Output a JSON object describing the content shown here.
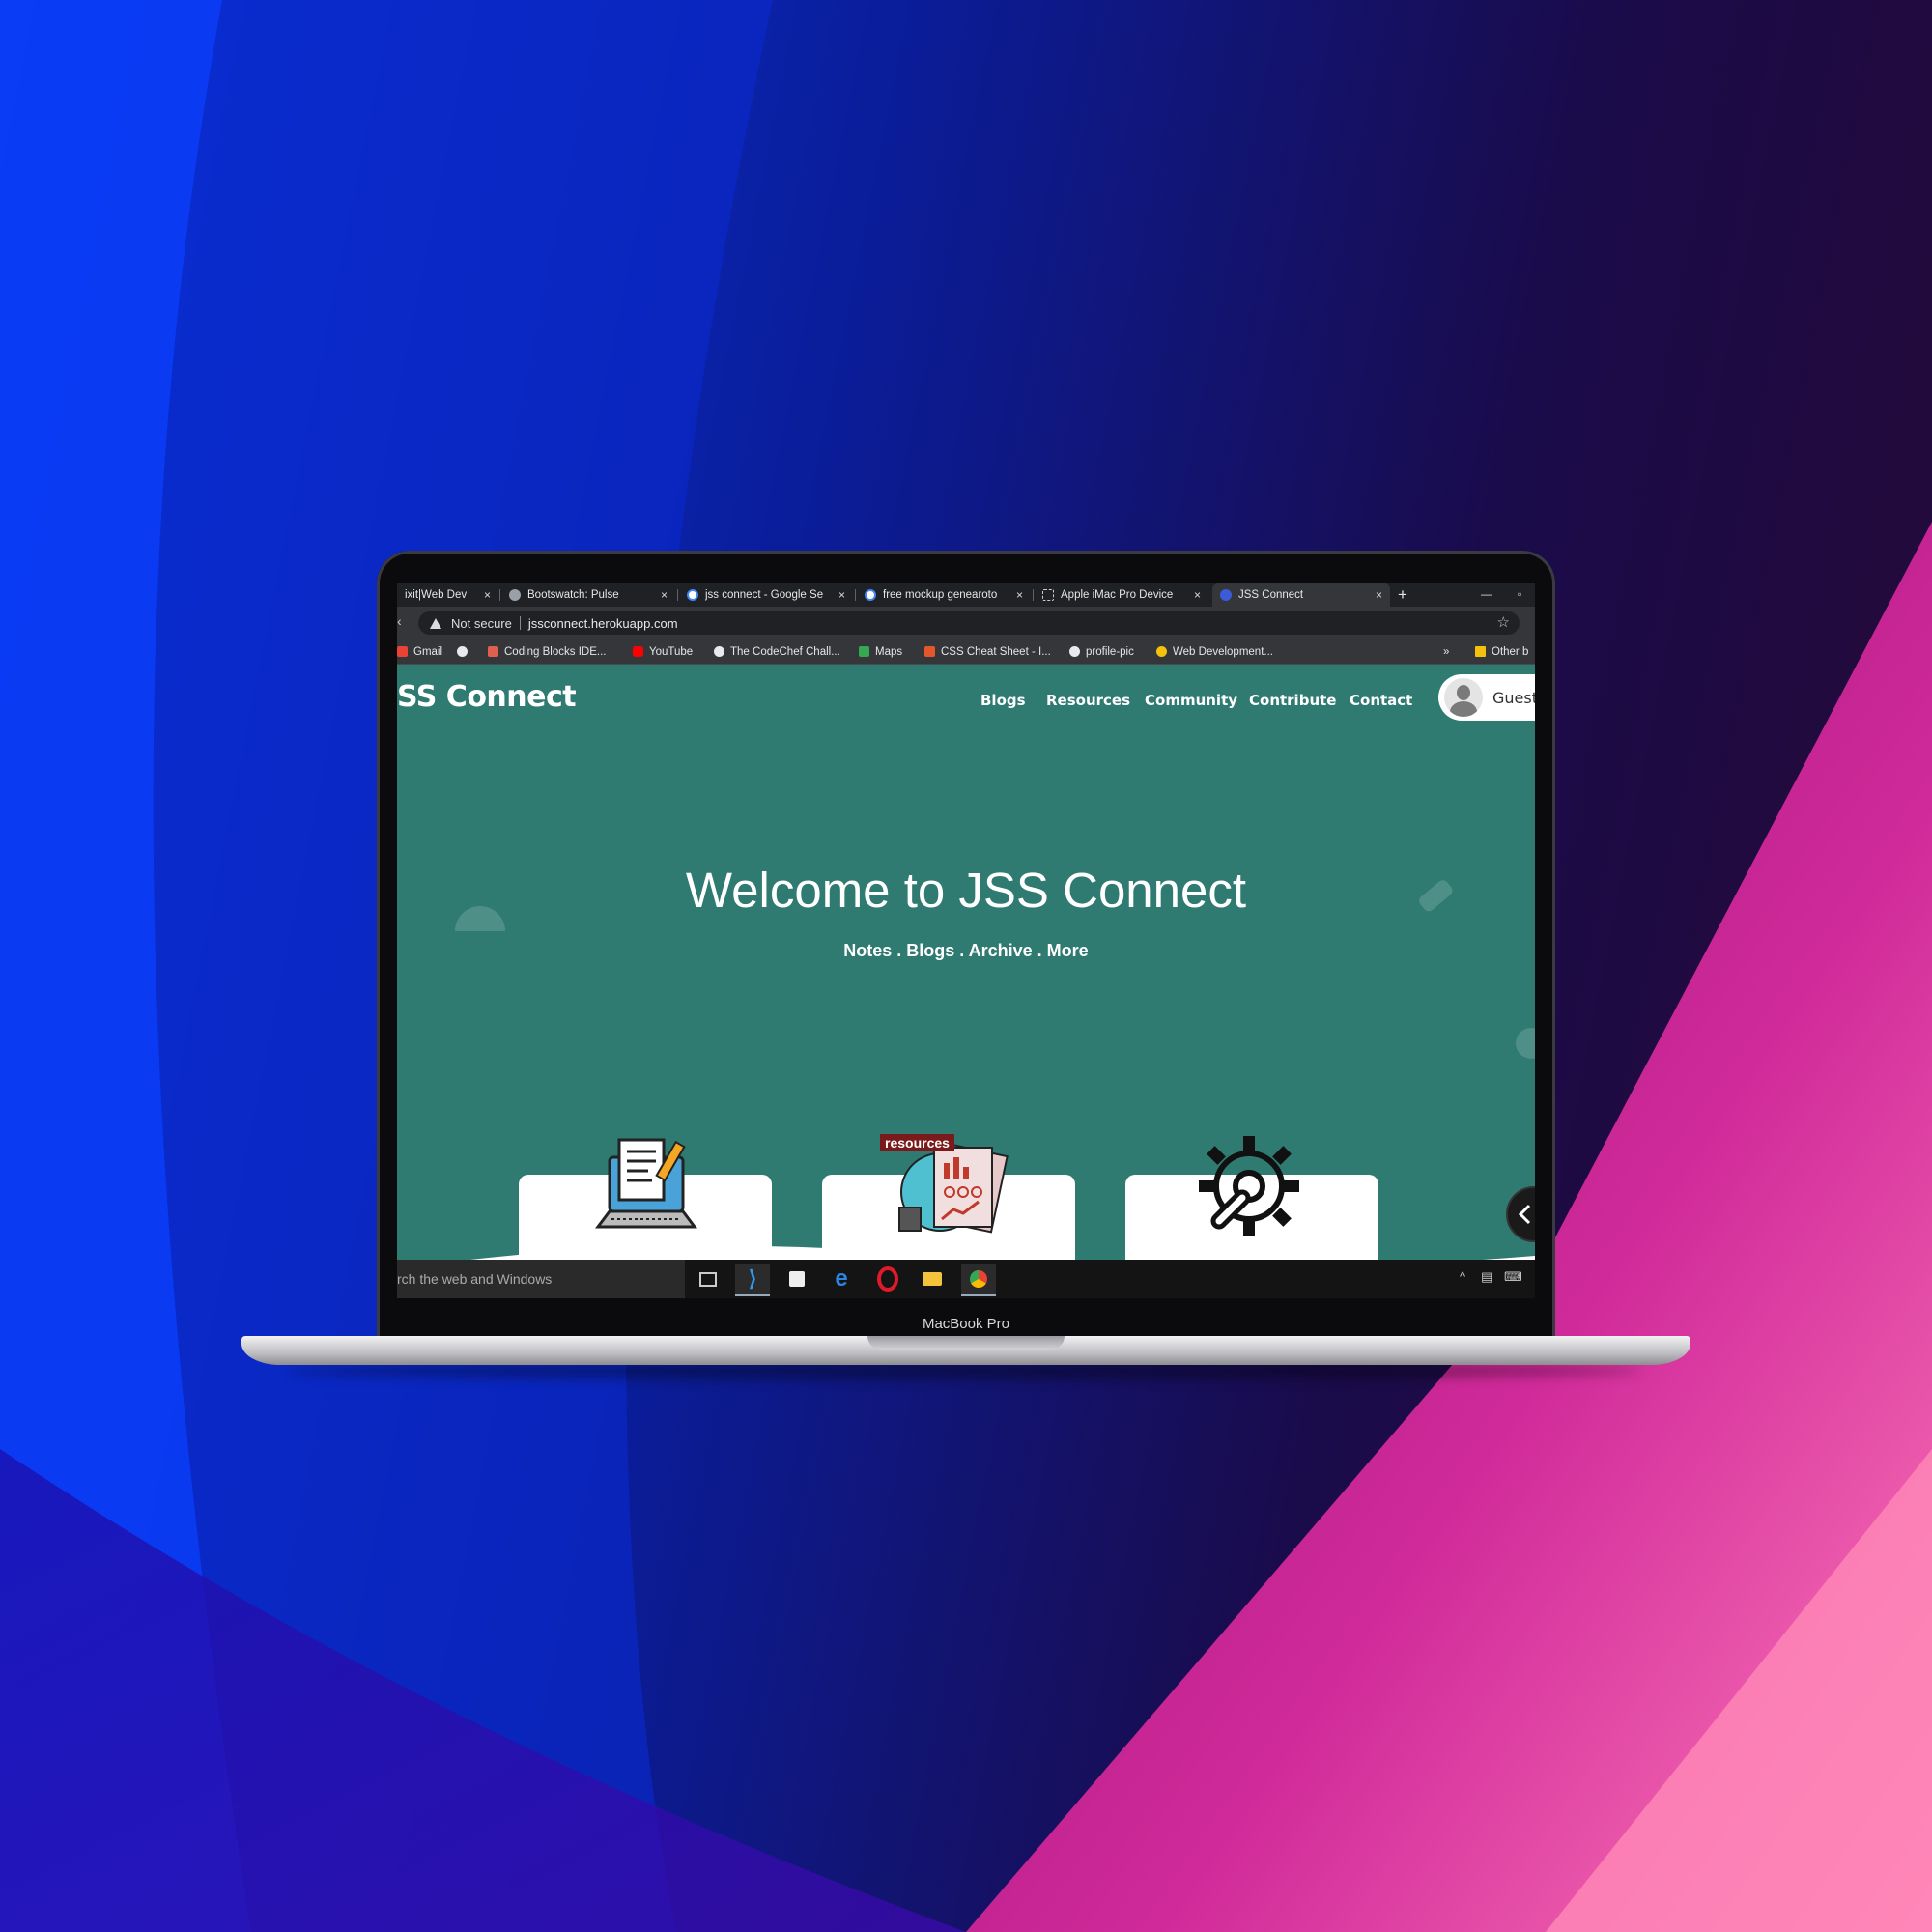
{
  "device": {
    "model_label": "MacBook Pro"
  },
  "browser": {
    "tabs": [
      {
        "title": "ixit|Web Dev",
        "favicon_color": "#8ab4f8"
      },
      {
        "title": "Bootswatch: Pulse",
        "favicon_color": "#9aa0a6"
      },
      {
        "title": "jss connect - Google Se",
        "favicon_color": "#ffffff"
      },
      {
        "title": "free mockup genearoto",
        "favicon_color": "#ffffff"
      },
      {
        "title": "Apple iMac Pro Device",
        "favicon_color": "#9aa0a6"
      },
      {
        "title": "JSS Connect",
        "favicon_color": "#3b5bd9"
      }
    ],
    "tab_close_glyph": "×",
    "new_tab_glyph": "+",
    "minimize_glyph": "—",
    "maximize_glyph": "▫",
    "security_label": "Not secure",
    "url": "jssconnect.herokuapp.com",
    "bookmarks": [
      {
        "label": "Gmail",
        "color": "#ea4335"
      },
      {
        "label": "",
        "color": "#e8eaed"
      },
      {
        "label": "Coding Blocks IDE...",
        "color": "#e06050"
      },
      {
        "label": "YouTube",
        "color": "#ff0000"
      },
      {
        "label": "The CodeChef Chall...",
        "color": "#e8eaed"
      },
      {
        "label": "Maps",
        "color": "#34a853"
      },
      {
        "label": "CSS Cheat Sheet - I...",
        "color": "#e2572b"
      },
      {
        "label": "profile-pic",
        "color": "#e8eaed"
      },
      {
        "label": "Web Development...",
        "color": "#f4c20d"
      }
    ],
    "bookmarks_overflow": "»",
    "other_bookmarks": "Other b"
  },
  "site": {
    "brand": "SS Connect",
    "nav": [
      "Blogs",
      "Resources",
      "Community",
      "Contribute",
      "Contact"
    ],
    "user_label": "Guest",
    "hero_title": "Welcome to JSS Connect",
    "hero_subtitle": "Notes . Blogs . Archive . More",
    "resources_tag": "resources",
    "accent_color": "#2f7a71"
  },
  "taskbar": {
    "search_placeholder": "rch the web and Windows",
    "apps": [
      "task-view",
      "vscode",
      "store",
      "edge",
      "opera",
      "file-explorer",
      "chrome"
    ]
  }
}
